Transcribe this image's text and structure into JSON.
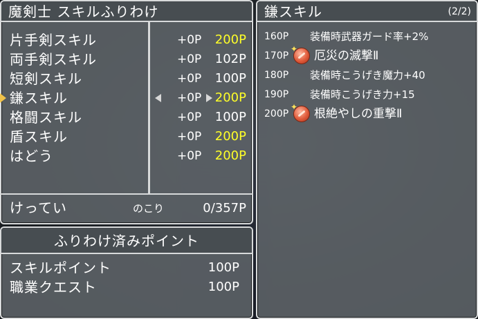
{
  "skill_panel": {
    "title": "魔剣士 スキルふりわけ",
    "skills": [
      {
        "name": "片手剣スキル",
        "alloc": "+0P",
        "total": "200P",
        "max": true
      },
      {
        "name": "両手剣スキル",
        "alloc": "+0P",
        "total": "102P",
        "max": false
      },
      {
        "name": "短剣スキル",
        "alloc": "+0P",
        "total": "100P",
        "max": false
      },
      {
        "name": "鎌スキル",
        "alloc": "+0P",
        "total": "200P",
        "max": true
      },
      {
        "name": "格闘スキル",
        "alloc": "+0P",
        "total": "100P",
        "max": false
      },
      {
        "name": "盾スキル",
        "alloc": "+0P",
        "total": "200P",
        "max": true
      },
      {
        "name": "はどう",
        "alloc": "+0P",
        "total": "200P",
        "max": true
      }
    ],
    "confirm_label": "けってい",
    "remaining_label": "のこり",
    "remaining_value": "0/357P"
  },
  "points_panel": {
    "title": "ふりわけ済みポイント",
    "rows": [
      {
        "name": "スキルポイント",
        "value": "100P"
      },
      {
        "name": "職業クエスト",
        "value": "100P"
      }
    ]
  },
  "detail_panel": {
    "title": "鎌スキル",
    "page": "(2/2)",
    "rows": [
      {
        "points": "160P",
        "desc": "装備時武器ガード率+2%",
        "special": false
      },
      {
        "points": "170P",
        "desc": "厄災の滅撃Ⅱ",
        "special": true
      },
      {
        "points": "180P",
        "desc": "装備時こうげき魔力+40",
        "special": false
      },
      {
        "points": "190P",
        "desc": "装備時こうげき力+15",
        "special": false
      },
      {
        "points": "200P",
        "desc": "根絶やしの重撃Ⅱ",
        "special": true
      }
    ]
  },
  "colors": {
    "max_value": "#ffff28",
    "panel_bg": "#5f656a",
    "border": "#d8dadb",
    "cursor": "#f0c24a"
  },
  "icons": {
    "cursor": "selection-cursor-icon",
    "left": "arrow-left-icon",
    "right": "arrow-right-icon",
    "special": "special-skill-orb-icon"
  },
  "selected_skill": "鎌スキル"
}
